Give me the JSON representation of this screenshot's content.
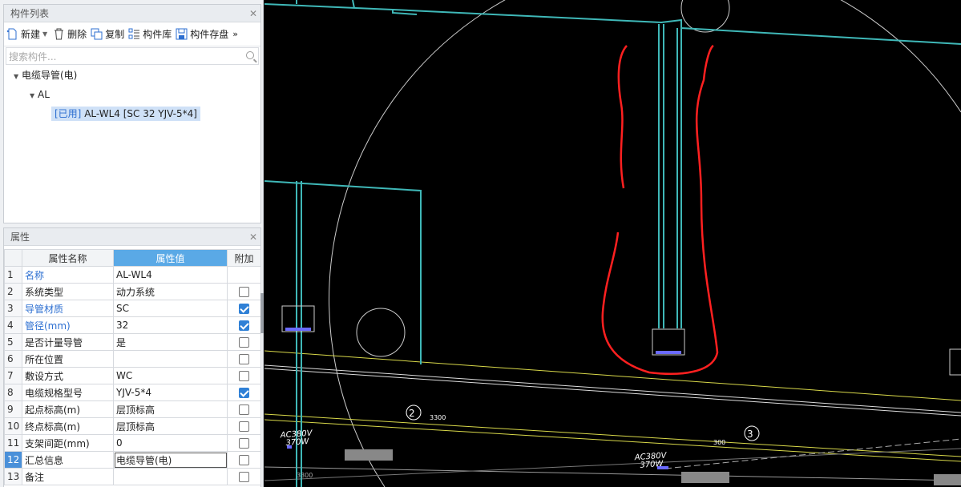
{
  "component_panel": {
    "title": "构件列表",
    "toolbar": {
      "new_label": "新建",
      "delete_label": "删除",
      "copy_label": "复制",
      "library_label": "构件库",
      "save_label": "构件存盘",
      "more": "»"
    },
    "search_placeholder": "搜索构件...",
    "tree": {
      "root_label": "电缆导管(电)",
      "group_label": "AL",
      "item_used_tag": "[已用]",
      "item_label": "AL-WL4 [SC 32 YJV-5*4]"
    }
  },
  "property_panel": {
    "title": "属性",
    "headers": {
      "name": "属性名称",
      "value": "属性值",
      "extra": "附加"
    },
    "rows": [
      {
        "num": "1",
        "name": "名称",
        "value": "AL-WL4",
        "checkbox": false,
        "checked": false,
        "blue": true
      },
      {
        "num": "2",
        "name": "系统类型",
        "value": "动力系统",
        "checkbox": true,
        "checked": false,
        "blue": false
      },
      {
        "num": "3",
        "name": "导管材质",
        "value": "SC",
        "checkbox": true,
        "checked": true,
        "blue": true
      },
      {
        "num": "4",
        "name": "管径(mm)",
        "value": "32",
        "checkbox": true,
        "checked": true,
        "blue": true
      },
      {
        "num": "5",
        "name": "是否计量导管",
        "value": "是",
        "checkbox": true,
        "checked": false,
        "blue": false
      },
      {
        "num": "6",
        "name": "所在位置",
        "value": "",
        "checkbox": true,
        "checked": false,
        "blue": false
      },
      {
        "num": "7",
        "name": "敷设方式",
        "value": "WC",
        "checkbox": true,
        "checked": false,
        "blue": false
      },
      {
        "num": "8",
        "name": "电缆规格型号",
        "value": "YJV-5*4",
        "checkbox": true,
        "checked": true,
        "blue": false
      },
      {
        "num": "9",
        "name": "起点标高(m)",
        "value": "层顶标高",
        "checkbox": true,
        "checked": false,
        "blue": false
      },
      {
        "num": "10",
        "name": "终点标高(m)",
        "value": "层顶标高",
        "checkbox": true,
        "checked": false,
        "blue": false
      },
      {
        "num": "11",
        "name": "支架间距(mm)",
        "value": "0",
        "checkbox": true,
        "checked": false,
        "blue": false
      },
      {
        "num": "12",
        "name": "汇总信息",
        "value": "电缆导管(电)",
        "checkbox": true,
        "checked": false,
        "blue": false
      },
      {
        "num": "13",
        "name": "备注",
        "value": "",
        "checkbox": true,
        "checked": false,
        "blue": false
      }
    ]
  },
  "drawing": {
    "labels": {
      "axis2": "2",
      "axis3": "3",
      "dim1": "3300",
      "dim2": "300",
      "dim3": "3300",
      "ac1_line1": "AC380V",
      "ac1_line2": "370W",
      "ac2_line1": "AC380V",
      "ac2_line2": "370W"
    },
    "colors": {
      "wall": "#3fb8b8",
      "annotation": "#ff2020",
      "grid": "#d9d94a",
      "circle": "#cccccc",
      "background": "#000000"
    }
  }
}
